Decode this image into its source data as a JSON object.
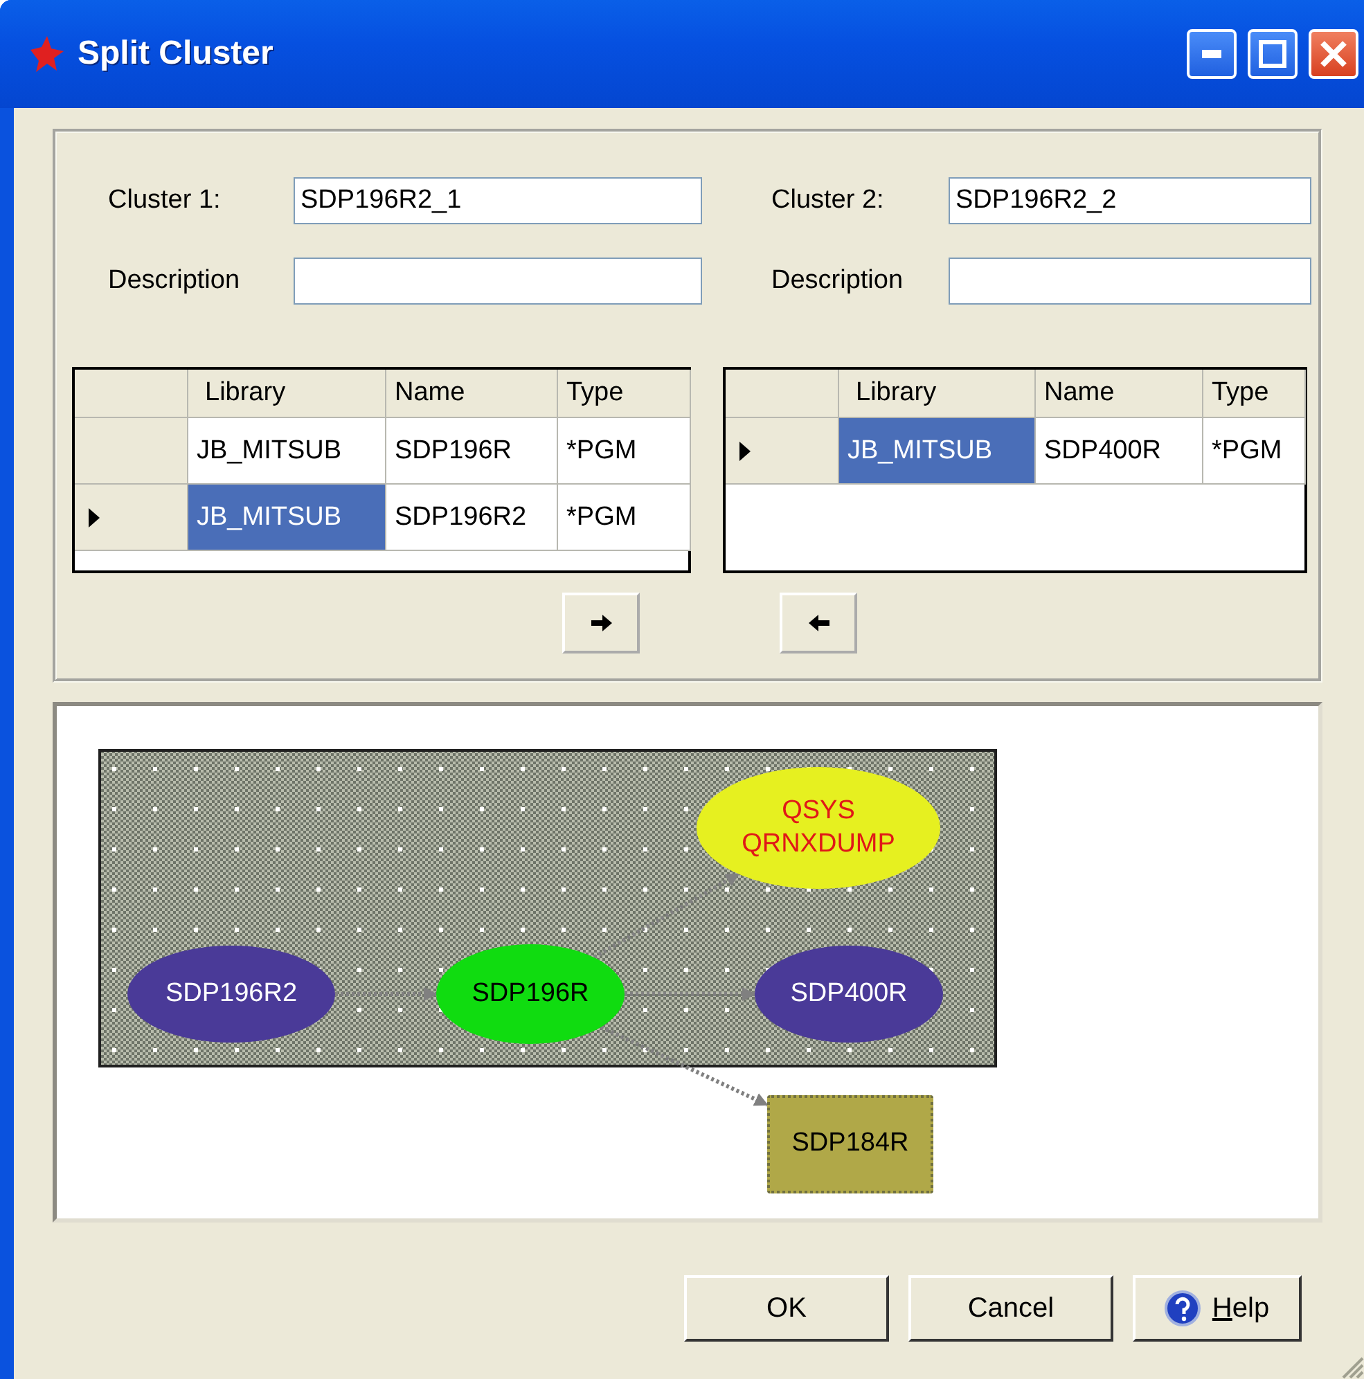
{
  "window": {
    "title": "Split Cluster",
    "controls": [
      {
        "kind": "minimize"
      },
      {
        "kind": "maximize"
      },
      {
        "kind": "close"
      }
    ]
  },
  "clusters": [
    {
      "name_label": "Cluster 1:",
      "name_value": "SDP196R2_1",
      "description_label": "Description"
    },
    {
      "name_label": "Cluster 2:",
      "name_value": "SDP196R2_2",
      "description_label": "Description"
    }
  ],
  "grids": [
    {
      "columns": [
        "Library",
        "Name",
        "Type"
      ],
      "rows": [
        {
          "cells": [
            "JB_MITSUB",
            "SDP196R",
            "*PGM"
          ],
          "current": false,
          "selected": false
        },
        {
          "cells": [
            "JB_MITSUB",
            "SDP196R2",
            "*PGM"
          ],
          "current": true,
          "selected": true
        }
      ]
    },
    {
      "columns": [
        "Library",
        "Name",
        "Type"
      ],
      "rows": [
        {
          "cells": [
            "JB_MITSUB",
            "SDP400R",
            "*PGM"
          ],
          "current": true,
          "selected": true
        }
      ]
    }
  ],
  "move_buttons": [
    {
      "kind": "right"
    },
    {
      "kind": "left"
    }
  ],
  "graph": {
    "nodes": [
      {
        "kind": "ellipse",
        "lines": [
          "QSYS",
          "QRNXDUMP"
        ],
        "color": "#e6f020"
      },
      {
        "kind": "ellipse",
        "lines": [
          "SDP196R2"
        ],
        "color": "#4a3a98"
      },
      {
        "kind": "ellipse",
        "lines": [
          "SDP196R"
        ],
        "color": "#10dc10"
      },
      {
        "kind": "ellipse",
        "lines": [
          "SDP400R"
        ],
        "color": "#4a3a98"
      },
      {
        "kind": "rect",
        "lines": [
          "SDP184R"
        ],
        "color": "#b0a848"
      }
    ]
  },
  "buttons": [
    {
      "kind": "ok",
      "label": "OK"
    },
    {
      "kind": "cancel",
      "label": "Cancel"
    },
    {
      "kind": "help",
      "label": "Help"
    }
  ]
}
